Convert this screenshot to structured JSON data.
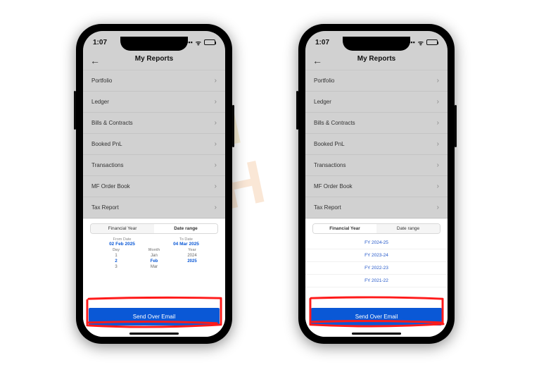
{
  "watermark": {
    "line1": "IN",
    "line2": "H"
  },
  "status": {
    "time": "1:07"
  },
  "header": {
    "title": "My Reports"
  },
  "reports": [
    {
      "label": "Portfolio"
    },
    {
      "label": "Ledger"
    },
    {
      "label": "Bills & Contracts"
    },
    {
      "label": "Booked PnL"
    },
    {
      "label": "Transactions"
    },
    {
      "label": "MF Order Book"
    },
    {
      "label": "Tax Report"
    }
  ],
  "segmented": {
    "financial_year": "Financial Year",
    "date_range": "Date range"
  },
  "date_picker": {
    "from_label": "From Date",
    "from_value": "02 Feb 2025",
    "to_label": "To Date",
    "to_value": "04 Mar 2025",
    "col_headers": {
      "day": "Day",
      "month": "Month",
      "year": "Year"
    },
    "rows": [
      {
        "day": "1",
        "month": "Jan",
        "year": "2024",
        "selected": false
      },
      {
        "day": "2",
        "month": "Feb",
        "year": "2025",
        "selected": true
      },
      {
        "day": "3",
        "month": "Mar",
        "year": "",
        "selected": false
      }
    ]
  },
  "fy_options": [
    "FY 2024-25",
    "FY 2023-24",
    "FY 2022-23",
    "FY 2021-22"
  ],
  "cta": {
    "label": "Send Over Email"
  }
}
